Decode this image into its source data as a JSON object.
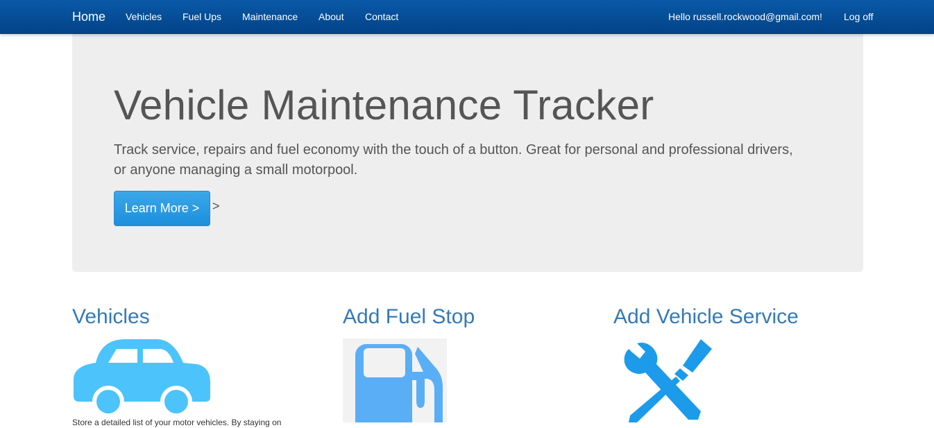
{
  "nav": {
    "brand": "Home",
    "links": [
      "Vehicles",
      "Fuel Ups",
      "Maintenance",
      "About",
      "Contact"
    ],
    "greeting": "Hello russell.rockwood@gmail.com!",
    "logoff": "Log off"
  },
  "jumbotron": {
    "title": "Vehicle Maintenance Tracker",
    "text": "Track service, repairs and fuel economy with the touch of a button. Great for personal and professional drivers, or anyone managing a small motorpool.",
    "button_label": "Learn More >",
    "button_suffix": ">"
  },
  "cards": [
    {
      "title": "Vehicles",
      "icon": "car-icon",
      "text": "Store a detailed list of your motor vehicles. By staying on"
    },
    {
      "title": "Add Fuel Stop",
      "icon": "fuel-pump-icon"
    },
    {
      "title": "Add Vehicle Service",
      "icon": "wrench-screwdriver-icon"
    }
  ],
  "colors": {
    "navbar": "#024389",
    "heading_link": "#337ab7",
    "button": "#1d8fdd",
    "jumbotron_bg": "#eeeeee",
    "car_icon": "#4cc3fb",
    "fuel_icon": "#5aaef6",
    "tools_icon": "#1b9bea"
  }
}
